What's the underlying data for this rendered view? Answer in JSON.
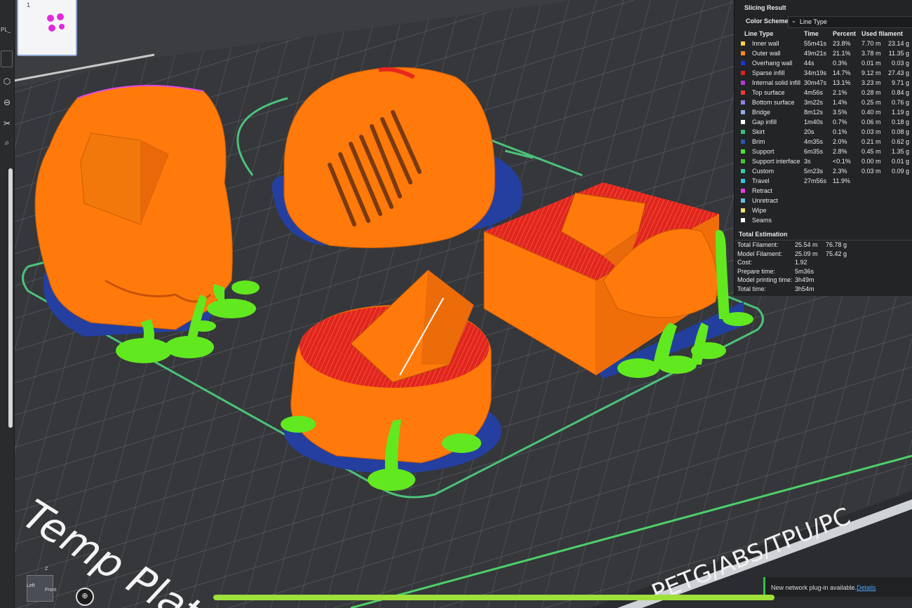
{
  "plate": {
    "thumb_number": "1",
    "name_text": "Temp Plat",
    "material_text": "PETG/ABS/TPU/PC"
  },
  "left_toolbar": {
    "truncated_label": "PL_"
  },
  "slicing": {
    "title": "Slicing Result",
    "color_scheme_label": "Color Scheme",
    "color_scheme_value": "Line Type",
    "columns": {
      "type": "Line Type",
      "time": "Time",
      "percent": "Percent",
      "used": "Used filament"
    },
    "rows": [
      {
        "name": "Inner wall",
        "color": "#f7d23b",
        "time": "55m41s",
        "percent": "23.8%",
        "length": "7.70 m",
        "grams": "23.14 g"
      },
      {
        "name": "Outer wall",
        "color": "#ff8a1e",
        "time": "49m21s",
        "percent": "21.1%",
        "length": "3.78 m",
        "grams": "11.35 g"
      },
      {
        "name": "Overhang wall",
        "color": "#1d35d8",
        "time": "44s",
        "percent": "0.3%",
        "length": "0.01 m",
        "grams": "0.03 g"
      },
      {
        "name": "Sparse infill",
        "color": "#e81f1f",
        "time": "34m19s",
        "percent": "14.7%",
        "length": "9.12 m",
        "grams": "27.43 g"
      },
      {
        "name": "Internal solid infill",
        "color": "#b43bd6",
        "time": "30m47s",
        "percent": "13.1%",
        "length": "3.23 m",
        "grams": "9.71 g"
      },
      {
        "name": "Top surface",
        "color": "#f03a3a",
        "time": "4m56s",
        "percent": "2.1%",
        "length": "0.28 m",
        "grams": "0.84 g"
      },
      {
        "name": "Bottom surface",
        "color": "#8a86e0",
        "time": "3m22s",
        "percent": "1.4%",
        "length": "0.25 m",
        "grams": "0.76 g"
      },
      {
        "name": "Bridge",
        "color": "#8fb0e0",
        "time": "8m12s",
        "percent": "3.5%",
        "length": "0.40 m",
        "grams": "1.19 g"
      },
      {
        "name": "Gap infill",
        "color": "#ffffff",
        "time": "1m40s",
        "percent": "0.7%",
        "length": "0.06 m",
        "grams": "0.18 g"
      },
      {
        "name": "Skirt",
        "color": "#35c07a",
        "time": "20s",
        "percent": "0.1%",
        "length": "0.03 m",
        "grams": "0.08 g"
      },
      {
        "name": "Brim",
        "color": "#2e55b0",
        "time": "4m35s",
        "percent": "2.0%",
        "length": "0.21 m",
        "grams": "0.62 g"
      },
      {
        "name": "Support",
        "color": "#4ee52b",
        "time": "6m35s",
        "percent": "2.8%",
        "length": "0.45 m",
        "grams": "1.35 g"
      },
      {
        "name": "Support interface",
        "color": "#49c23b",
        "time": "3s",
        "percent": "<0.1%",
        "length": "0.00 m",
        "grams": "0.01 g"
      },
      {
        "name": "Custom",
        "color": "#34c9a8",
        "time": "5m23s",
        "percent": "2.3%",
        "length": "0.03 m",
        "grams": "0.09 g"
      },
      {
        "name": "Travel",
        "color": "#2fc3e0",
        "time": "27m56s",
        "percent": "11.9%",
        "length": "",
        "grams": ""
      },
      {
        "name": "Retract",
        "color": "#e83be0",
        "time": "",
        "percent": "",
        "length": "",
        "grams": ""
      },
      {
        "name": "Unretract",
        "color": "#68bde8",
        "time": "",
        "percent": "",
        "length": "",
        "grams": ""
      },
      {
        "name": "Wipe",
        "color": "#f3e27a",
        "time": "",
        "percent": "",
        "length": "",
        "grams": ""
      },
      {
        "name": "Seams",
        "color": "#ffffff",
        "time": "",
        "percent": "",
        "length": "",
        "grams": ""
      }
    ],
    "estimation": {
      "title": "Total Estimation",
      "items": [
        {
          "label": "Total Filament:",
          "value": "25.54 m",
          "value2": "76.78 g"
        },
        {
          "label": "Model Filament:",
          "value": "25.09 m",
          "value2": "75.42 g"
        },
        {
          "label": "Cost:",
          "value": "1.92",
          "value2": ""
        },
        {
          "label": "Prepare time:",
          "value": "5m36s",
          "value2": ""
        },
        {
          "label": "Model printing time:",
          "value": "3h49m",
          "value2": ""
        },
        {
          "label": "Total time:",
          "value": "3h54m",
          "value2": ""
        }
      ]
    }
  },
  "notification": {
    "message": "New network plug-in available.",
    "link": "Details"
  },
  "nav_cube": {
    "z_label": "Z",
    "left_label": "Left",
    "front_label": "Front"
  },
  "colors": {
    "model": "#ff7a0a",
    "support": "#62e81f",
    "brim": "#223f9e",
    "infill": "#e8261e",
    "skirt": "#4cc27a"
  }
}
